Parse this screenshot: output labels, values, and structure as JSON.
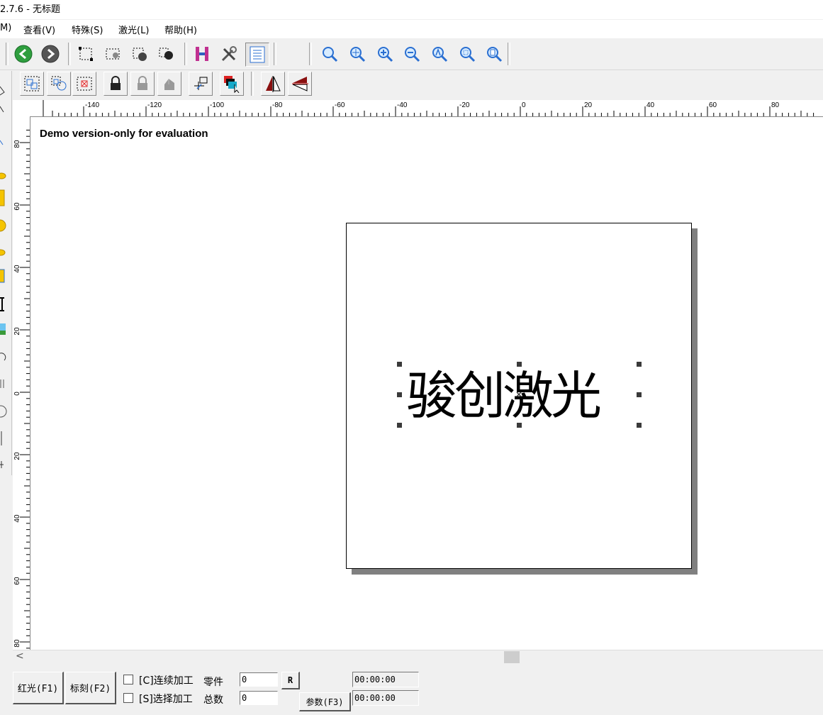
{
  "window": {
    "title": "2.7.6 - 无标题"
  },
  "menu": [
    "M)",
    "查看(V)",
    "特殊(S)",
    "激光(L)",
    "帮助(H)"
  ],
  "toolbar1": {
    "icons": [
      "back-icon",
      "forward-icon",
      "node-edit-icon",
      "node-select-icon",
      "node-add-icon",
      "node-delete-icon",
      "hatch-icon",
      "tools-icon",
      "properties-icon",
      "zoom-icon",
      "zoom-pan-icon",
      "zoom-in-icon",
      "zoom-out-icon",
      "zoom-all-icon",
      "zoom-select-icon",
      "zoom-page-icon"
    ]
  },
  "toolbar2": {
    "icons": [
      "group-icon",
      "ungroup-icon",
      "select-box-icon",
      "lock-icon",
      "unlock-icon",
      "unlock-all-icon",
      "move-origin-icon",
      "array-icon",
      "mirror-horizontal-icon",
      "mirror-vertical-icon"
    ]
  },
  "rulers": {
    "horizontal_labels": [
      "-140",
      "-120",
      "-100",
      "-80",
      "-60",
      "-40",
      "-20",
      "0",
      "20",
      "40",
      "60",
      "80"
    ],
    "vertical_labels": [
      "80",
      "60",
      "40",
      "20",
      "0",
      "20",
      "40",
      "60",
      "80"
    ]
  },
  "canvas": {
    "watermark": "Demo version-only for evaluation",
    "mark_text": "骏创激光"
  },
  "bottom": {
    "red_light_button": "红光(F1)",
    "mark_button": "标刻(F2)",
    "continuous_label": "[C]连续加工",
    "select_label": "[S]选择加工",
    "parts_label": "零件",
    "total_label": "总数",
    "parts_value": "0",
    "total_value": "0",
    "reset_button": "R",
    "params_button": "参数(F3)",
    "timer1": "00:00:00",
    "timer2": "00:00:00"
  },
  "colors": {
    "accent_green": "#2e9e3e",
    "hatch_magenta": "#c03090",
    "zoom_blue": "#2a6fd1"
  }
}
